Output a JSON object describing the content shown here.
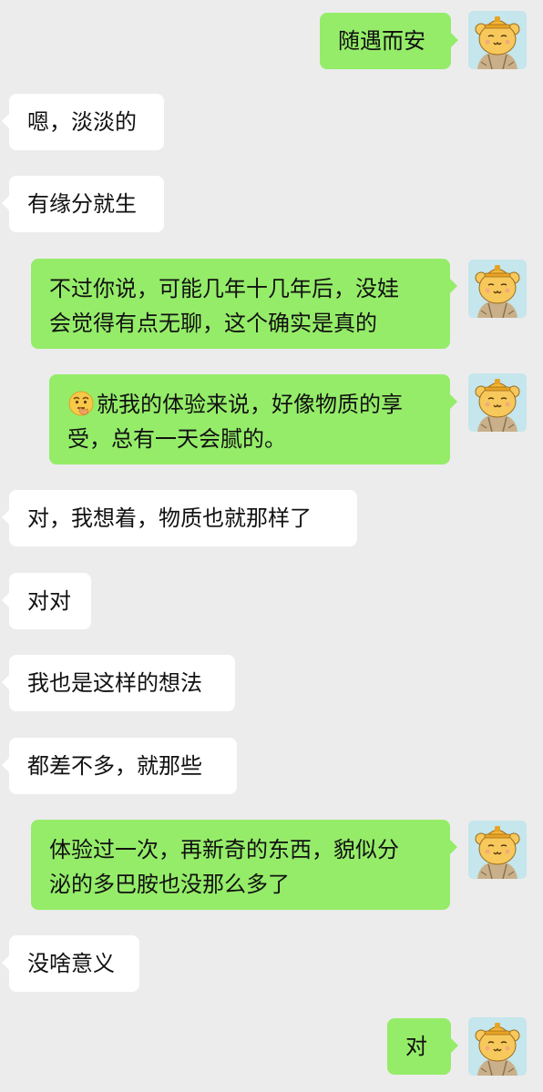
{
  "messages": [
    {
      "side": "out",
      "text": "随遇而安"
    },
    {
      "side": "in",
      "text": "嗯，淡淡的"
    },
    {
      "side": "in",
      "text": "有缘分就生"
    },
    {
      "side": "out",
      "line1": "不过你说，可能几年十几年后，没娃",
      "line2": "会觉得有点无聊，这个确实是真的"
    },
    {
      "side": "out",
      "emoji": "thinking-face-emoji",
      "line1": "就我的体验来说，好像物质的享",
      "line2": "受，总有一天会腻的。"
    },
    {
      "side": "in",
      "text": "对，我想着，物质也就那样了"
    },
    {
      "side": "in",
      "text": "对对"
    },
    {
      "side": "in",
      "text": "我也是这样的想法"
    },
    {
      "side": "in",
      "text": "都差不多，就那些"
    },
    {
      "side": "out",
      "line1": "体验过一次，再新奇的东西，貌似分",
      "line2": "泌的多巴胺也没那么多了"
    },
    {
      "side": "in",
      "text": "没啥意义"
    },
    {
      "side": "out",
      "text": "对"
    }
  ],
  "avatar_icon": "bear-with-hardhat-avatar",
  "colors": {
    "background": "#ececec",
    "incoming_bubble": "#ffffff",
    "outgoing_bubble": "#95ec69",
    "avatar_bg": "#bfe3ea"
  }
}
